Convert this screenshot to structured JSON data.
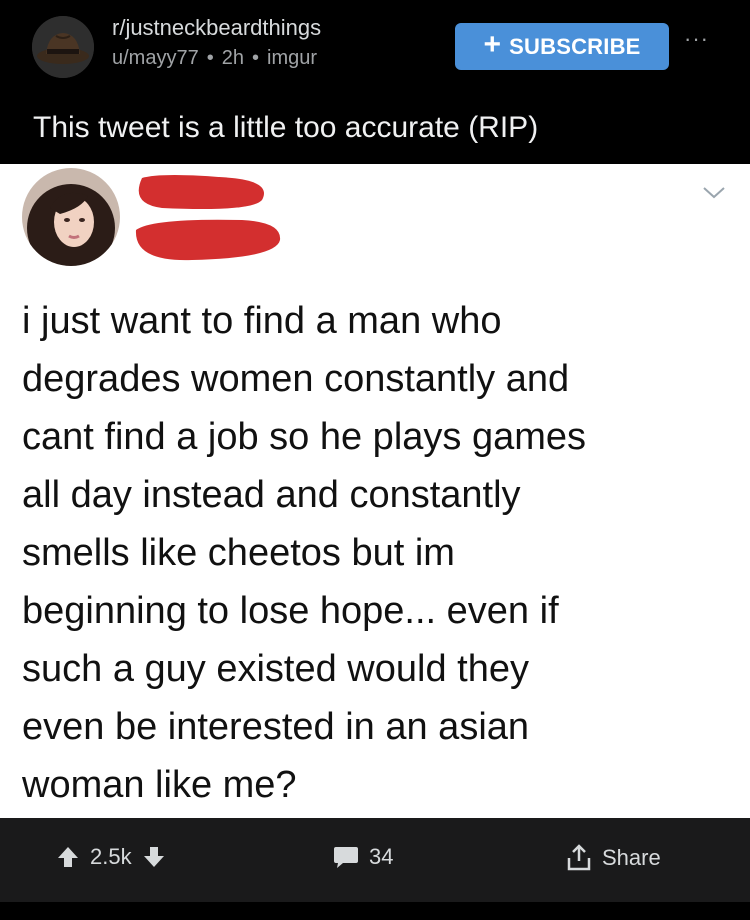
{
  "post": {
    "subreddit": "r/justneckbeardthings",
    "author": "u/mayy77",
    "age": "2h",
    "source": "imgur",
    "separator": "•",
    "title": "This tweet is a little too accurate (RIP)"
  },
  "header": {
    "subscribe_plus": "+",
    "subscribe_label": "SUBSCRIBE",
    "more_label": "···"
  },
  "tweet": {
    "lines": [
      "i just want to find a man who",
      "degrades women constantly and",
      "cant find a job so he plays games",
      "all day instead and constantly",
      "smells like cheetos but im",
      "beginning to lose hope... even if",
      "such a guy existed would they",
      "even be interested in an asian",
      "woman like me?"
    ],
    "redaction_color": "#d32f2f"
  },
  "actions": {
    "upvotes": "2.5k",
    "comments": "34",
    "share_label": "Share"
  },
  "colors": {
    "background": "#000000",
    "action_bar": "#1a1a1b",
    "subscribe": "#4a90d9"
  },
  "icons": {
    "subreddit_avatar": "fedora-hat-icon",
    "upvote": "arrow-up-icon",
    "downvote": "arrow-down-icon",
    "comment": "comment-bubble-icon",
    "share": "share-icon",
    "chevron": "chevron-down-icon"
  }
}
